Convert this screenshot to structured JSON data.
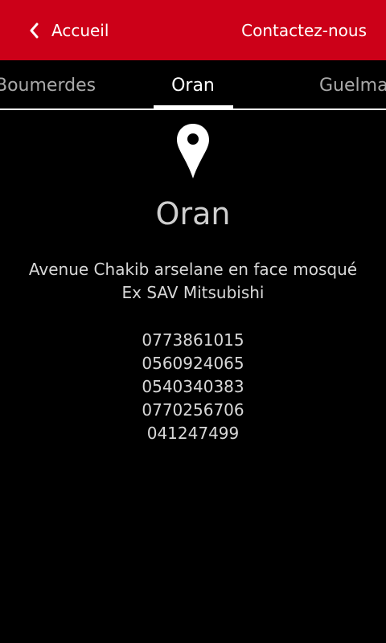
{
  "header": {
    "back_label": "Accueil",
    "back_icon": "chevron-left-icon",
    "contact_label": "Contactez-nous",
    "accent_color": "#cc0018"
  },
  "tabs": {
    "previous": "Boumerdes",
    "current": "Oran",
    "next": "Guelma"
  },
  "location": {
    "icon": "map-pin-icon",
    "city": "Oran",
    "address_line1": "Avenue Chakib arselane en face mosqué",
    "address_line2": "Ex SAV Mitsubishi",
    "phones": [
      "0773861015",
      "0560924065",
      "0540340383",
      "0770256706",
      "041247499"
    ]
  }
}
